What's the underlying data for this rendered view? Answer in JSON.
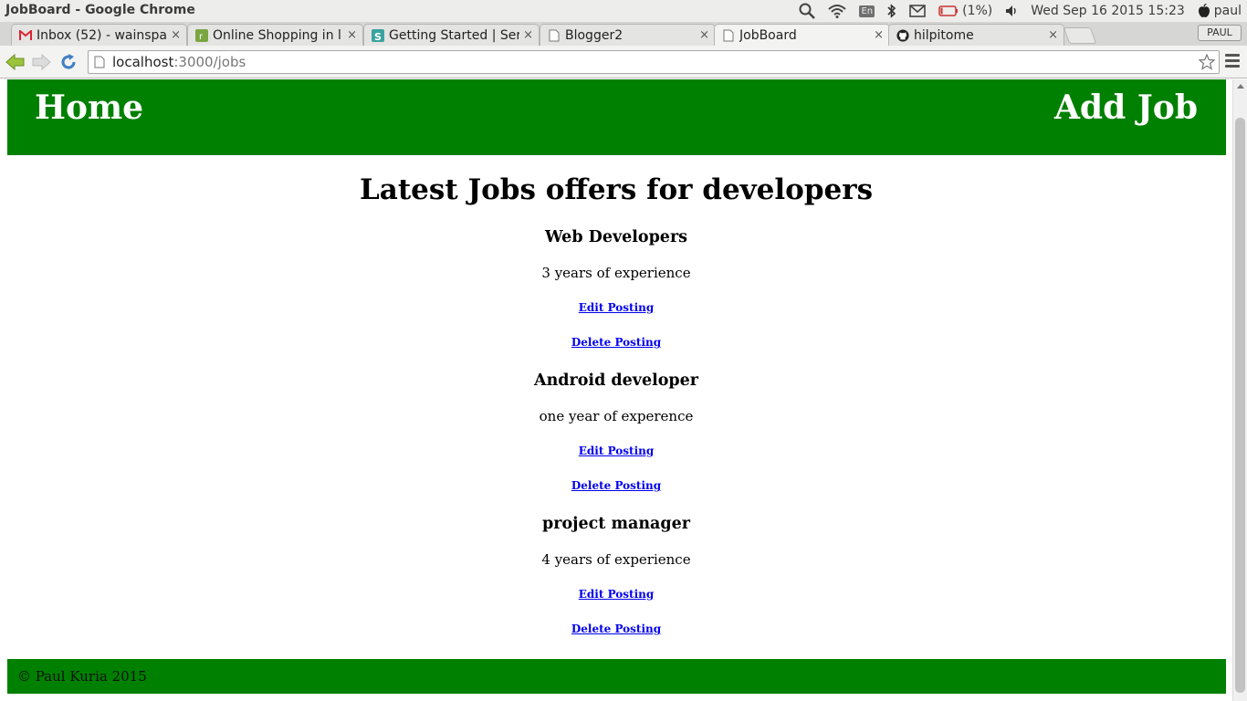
{
  "os_bar": {
    "window_title": "JobBoard - Google Chrome",
    "language": "En",
    "battery": "(1%)",
    "datetime": "Wed Sep 16 2015 15:23",
    "user": "paul"
  },
  "tabs": [
    {
      "label": "Inbox (52) - wainspa",
      "favicon": "gmail-icon"
    },
    {
      "label": "Online Shopping in l",
      "favicon": "store-icon"
    },
    {
      "label": "Getting Started | Ser",
      "favicon": "s-icon"
    },
    {
      "label": "Blogger2",
      "favicon": "page-icon"
    },
    {
      "label": "JobBoard",
      "favicon": "page-icon",
      "active": true
    },
    {
      "label": "hilpitome",
      "favicon": "github-icon"
    }
  ],
  "tab_close": "×",
  "profile_button": "PAUL",
  "address_bar": {
    "host": "localhost",
    "path": ":3000/jobs"
  },
  "site": {
    "nav_home": "Home",
    "nav_add_job": "Add Job",
    "heading": "Latest Jobs offers for developers",
    "jobs": [
      {
        "title": "Web Developers",
        "description": "3 years of experience",
        "edit": "Edit Posting",
        "delete": "Delete Posting"
      },
      {
        "title": "Android developer",
        "description": "one year of experence",
        "edit": "Edit Posting",
        "delete": "Delete Posting"
      },
      {
        "title": "project manager",
        "description": "4 years of experience",
        "edit": "Edit Posting",
        "delete": "Delete Posting"
      }
    ],
    "footer": "© Paul Kuria 2015"
  },
  "colors": {
    "brand_green": "#008000",
    "link_blue": "#0000ee"
  }
}
